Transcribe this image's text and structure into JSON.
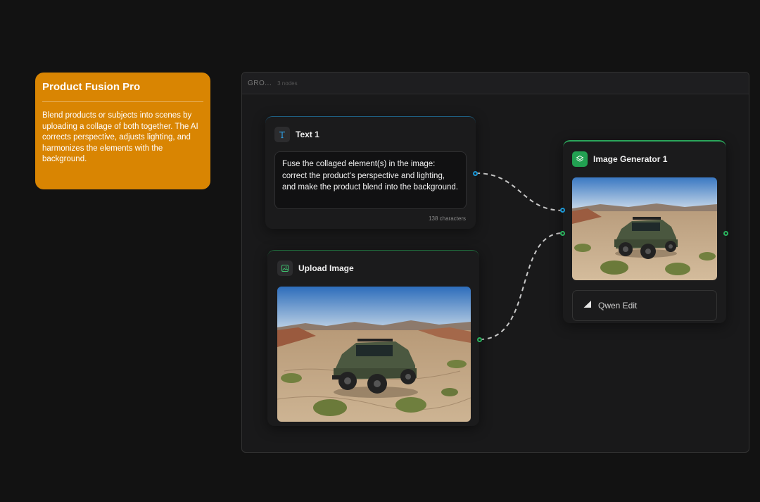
{
  "note": {
    "title": "Product Fusion Pro",
    "description": "Blend products or subjects into scenes by uploading a collage of both together. The AI corrects perspective, adjusts lighting, and harmonizes the elements with the background."
  },
  "group": {
    "name": "GRO...",
    "count": "3 nodes"
  },
  "text_node": {
    "title": "Text 1",
    "prompt": "Fuse the collaged element(s) in the image: correct the product's perspective and lighting, and make the product blend into the background.",
    "char_count": "138 characters"
  },
  "upload_node": {
    "title": "Upload Image"
  },
  "generator_node": {
    "title": "Image Generator 1",
    "model": "Qwen Edit"
  },
  "colors": {
    "note_bg": "#d98502",
    "text_port": "#1c98d6",
    "image_port": "#2ab35e",
    "generator_icon_bg": "#22a152"
  },
  "icons": {
    "text_node": "text-t-icon",
    "upload_node": "image-icon",
    "generator_node": "layers-icon",
    "model": "model-logo-icon"
  }
}
